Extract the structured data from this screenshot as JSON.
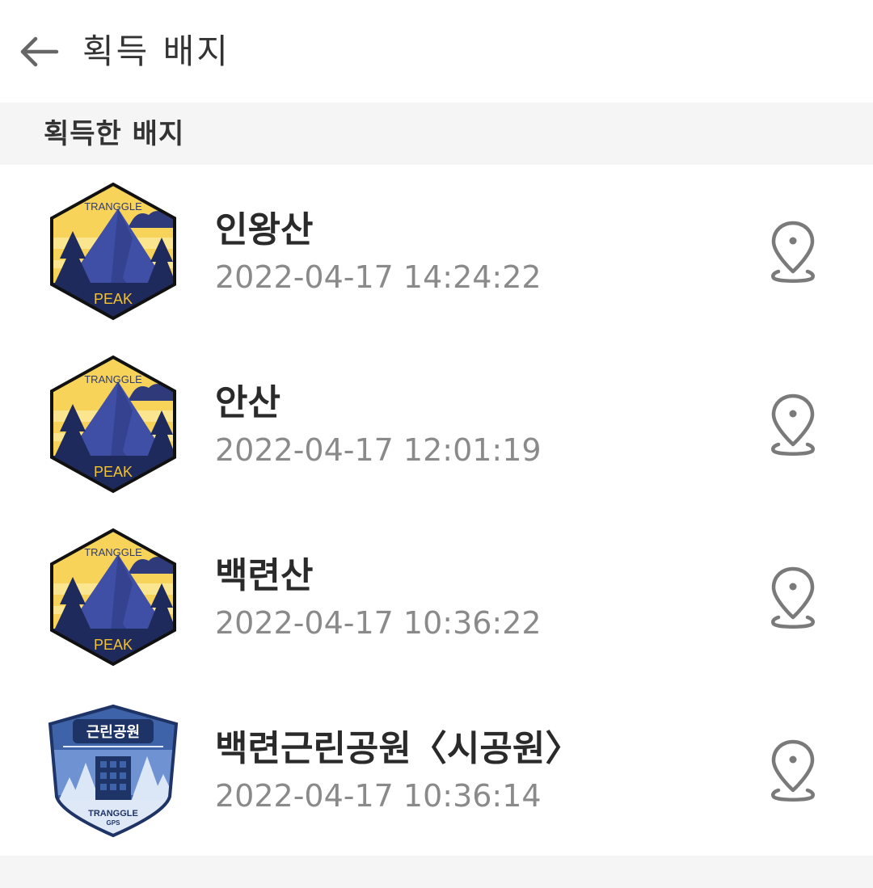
{
  "header": {
    "title": "획득 배지",
    "back_icon": "arrow-left-icon"
  },
  "section": {
    "title": "획득한 배지"
  },
  "badges": [
    {
      "name": "인왕산",
      "datetime": "2022-04-17 14:24:22",
      "badge_type": "peak",
      "badge_top_text": "TRANGGLE",
      "badge_bottom_text": "PEAK",
      "action_icon": "location-pin-icon"
    },
    {
      "name": "안산",
      "datetime": "2022-04-17 12:01:19",
      "badge_type": "peak",
      "badge_top_text": "TRANGGLE",
      "badge_bottom_text": "PEAK",
      "action_icon": "location-pin-icon"
    },
    {
      "name": "백련산",
      "datetime": "2022-04-17 10:36:22",
      "badge_type": "peak",
      "badge_top_text": "TRANGGLE",
      "badge_bottom_text": "PEAK",
      "action_icon": "location-pin-icon"
    },
    {
      "name": "백련근린공원〈시공원〉",
      "datetime": "2022-04-17 10:36:14",
      "badge_type": "park",
      "badge_top_text": "근린공원",
      "badge_bottom_text": "TRANGGLE",
      "badge_bottom_subtext": "GPS",
      "action_icon": "location-pin-icon"
    }
  ],
  "colors": {
    "peak_sky": "#f7d35a",
    "peak_mountain": "#3f4fa6",
    "peak_band": "#1f2a5c",
    "peak_text": "#f2c230",
    "park_shield": "#3f63a8",
    "text_primary": "#2a2a2a",
    "text_secondary": "#8a8a8a",
    "section_bg": "#f5f5f5"
  }
}
